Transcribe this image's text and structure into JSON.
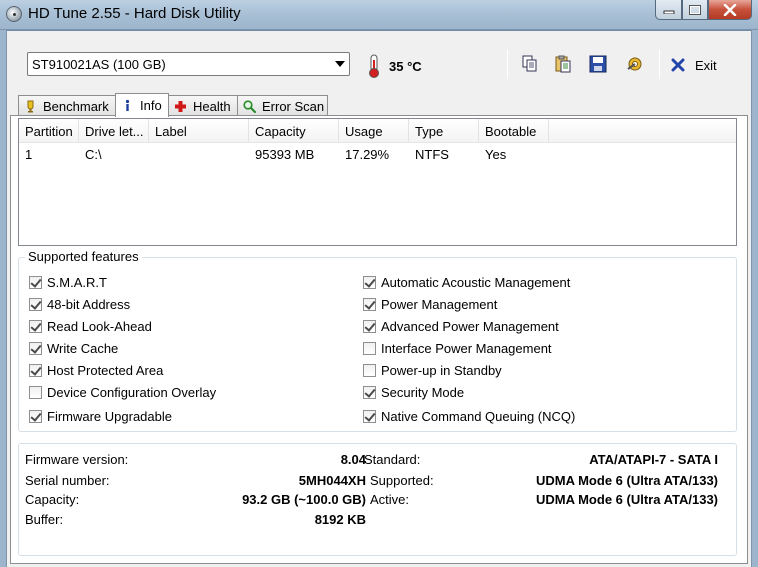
{
  "window": {
    "title": "HD Tune 2.55 - Hard Disk Utility"
  },
  "toolbar": {
    "drive": "ST910021AS (100 GB)",
    "temperature": "35 °C",
    "exit_label": "Exit"
  },
  "tabs": [
    {
      "label": "Benchmark",
      "icon": "benchmark-icon"
    },
    {
      "label": "Info",
      "icon": "info-icon"
    },
    {
      "label": "Health",
      "icon": "health-icon"
    },
    {
      "label": "Error Scan",
      "icon": "error-scan-icon"
    }
  ],
  "partitions": {
    "columns": [
      "Partition",
      "Drive let...",
      "Label",
      "Capacity",
      "Usage",
      "Type",
      "Bootable"
    ],
    "rows": [
      {
        "partition": "1",
        "drive": "C:\\",
        "label": "",
        "capacity": "95393 MB",
        "usage": "17.29%",
        "type": "NTFS",
        "bootable": "Yes"
      }
    ]
  },
  "features": {
    "title": "Supported features",
    "left": [
      {
        "label": "S.M.A.R.T",
        "checked": true
      },
      {
        "label": "48-bit Address",
        "checked": true
      },
      {
        "label": "Read Look-Ahead",
        "checked": true
      },
      {
        "label": "Write Cache",
        "checked": true
      },
      {
        "label": "Host Protected Area",
        "checked": true
      },
      {
        "label": "Device Configuration Overlay",
        "checked": false
      },
      {
        "label": "Firmware Upgradable",
        "checked": true
      }
    ],
    "right": [
      {
        "label": "Automatic Acoustic Management",
        "checked": true
      },
      {
        "label": "Power Management",
        "checked": true
      },
      {
        "label": "Advanced Power Management",
        "checked": true
      },
      {
        "label": "Interface Power Management",
        "checked": false
      },
      {
        "label": "Power-up in Standby",
        "checked": false
      },
      {
        "label": "Security Mode",
        "checked": true
      },
      {
        "label": "Native Command Queuing (NCQ)",
        "checked": true
      }
    ]
  },
  "details": {
    "firmware_label": "Firmware version:",
    "firmware_value": "8.04",
    "serial_label": "Serial number:",
    "serial_value": "5MH044XH",
    "capacity_label": "Capacity:",
    "capacity_value": "93.2 GB (~100.0 GB)",
    "buffer_label": "Buffer:",
    "buffer_value": "8192 KB",
    "standard_label": "Standard:",
    "standard_value": "ATA/ATAPI-7 - SATA I",
    "supported_label": "Supported:",
    "supported_value": "UDMA Mode 6 (Ultra ATA/133)",
    "active_label": "Active:",
    "active_value": "UDMA Mode 6 (Ultra ATA/133)"
  }
}
